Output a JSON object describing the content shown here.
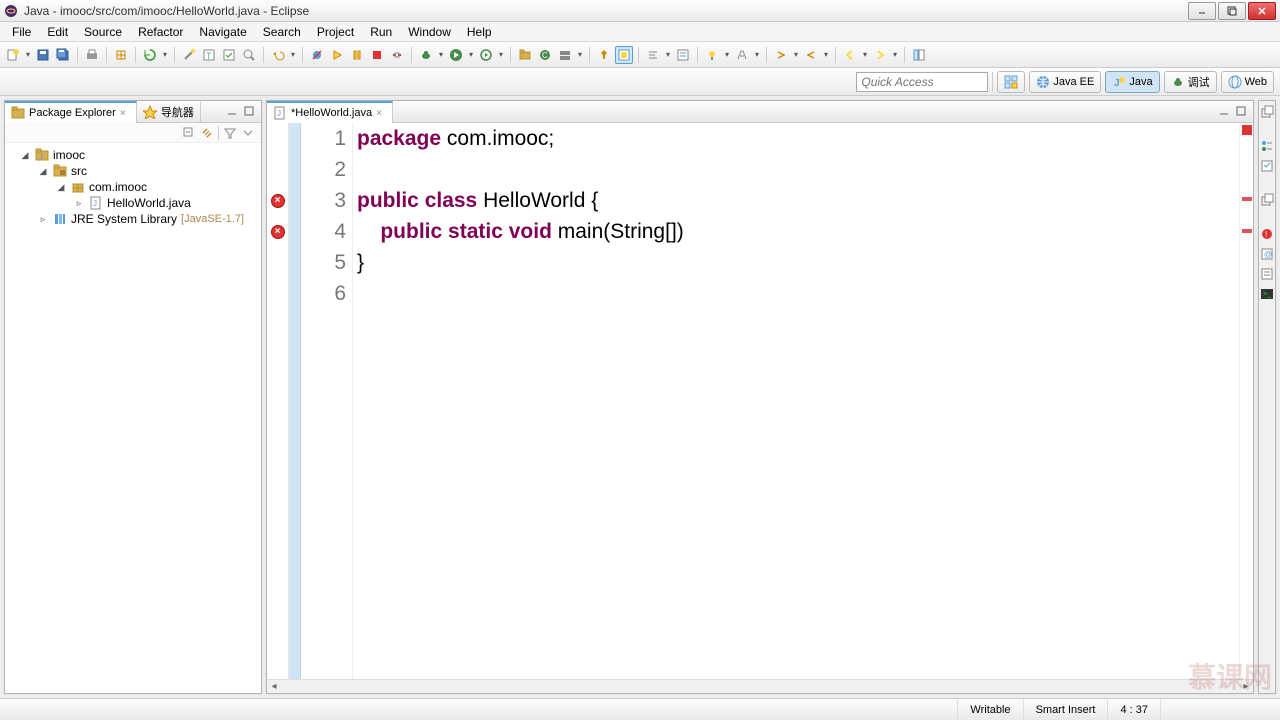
{
  "window": {
    "title": "Java - imooc/src/com/imooc/HelloWorld.java - Eclipse"
  },
  "menu": [
    "File",
    "Edit",
    "Source",
    "Refactor",
    "Navigate",
    "Search",
    "Project",
    "Run",
    "Window",
    "Help"
  ],
  "quickAccess": {
    "placeholder": "Quick Access"
  },
  "perspectives": [
    {
      "id": "open-perspective",
      "label": ""
    },
    {
      "id": "java-ee",
      "label": "Java EE"
    },
    {
      "id": "java",
      "label": "Java",
      "active": true
    },
    {
      "id": "debug",
      "label": "调试"
    },
    {
      "id": "web",
      "label": "Web"
    }
  ],
  "packageExplorer": {
    "title": "Package Explorer",
    "navigatorTab": "导航器",
    "tree": {
      "project": "imooc",
      "src": "src",
      "pkg": "com.imooc",
      "file": "HelloWorld.java",
      "jre": "JRE System Library",
      "jreDeco": "[JavaSE-1.7]"
    }
  },
  "editor": {
    "tabTitle": "*HelloWorld.java",
    "lines": [
      {
        "n": 1,
        "tokens": [
          [
            "kw",
            "package"
          ],
          [
            "plain",
            " com.imooc;"
          ]
        ]
      },
      {
        "n": 2,
        "tokens": [
          [
            "plain",
            ""
          ]
        ]
      },
      {
        "n": 3,
        "tokens": [
          [
            "kw",
            "public"
          ],
          [
            "plain",
            " "
          ],
          [
            "kw",
            "class"
          ],
          [
            "plain",
            " HelloWorld {"
          ]
        ],
        "error": true
      },
      {
        "n": 4,
        "tokens": [
          [
            "plain",
            "    "
          ],
          [
            "kw",
            "public"
          ],
          [
            "plain",
            " "
          ],
          [
            "kw",
            "static"
          ],
          [
            "plain",
            " "
          ],
          [
            "kw",
            "void"
          ],
          [
            "plain",
            " main(String[])"
          ]
        ],
        "error": true
      },
      {
        "n": 5,
        "tokens": [
          [
            "plain",
            "}"
          ]
        ]
      },
      {
        "n": 6,
        "tokens": [
          [
            "plain",
            ""
          ]
        ]
      }
    ]
  },
  "status": {
    "writable": "Writable",
    "insertMode": "Smart Insert",
    "cursor": "4 : 37"
  },
  "watermark": "慕课网"
}
